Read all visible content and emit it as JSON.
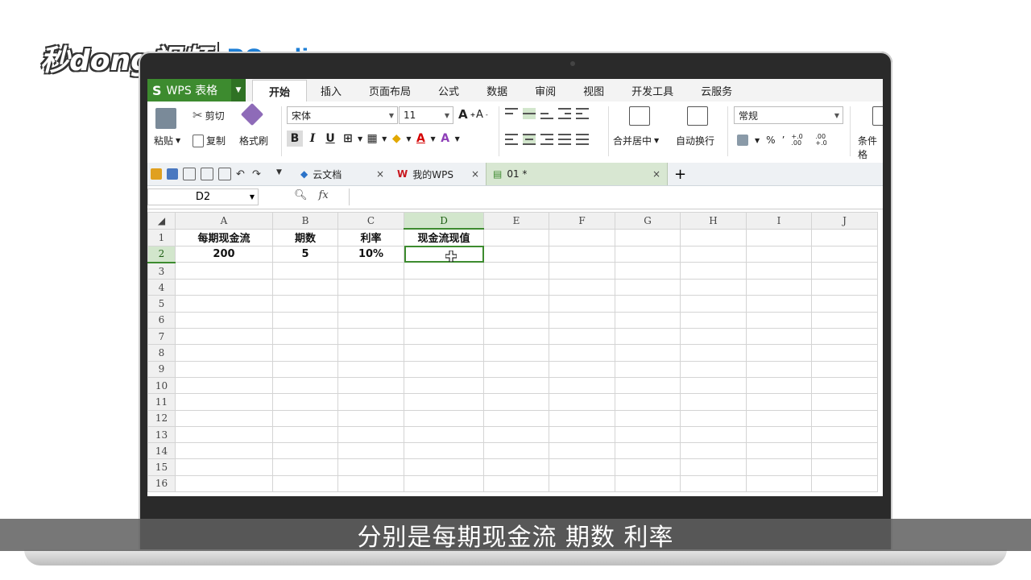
{
  "watermark": {
    "brand_cn": "秒dong视频",
    "brand_en": "PConline"
  },
  "menubar": {
    "app_name": "WPS 表格",
    "app_logo": "S",
    "tabs": [
      {
        "label": "开始",
        "active": true
      },
      {
        "label": "插入"
      },
      {
        "label": "页面布局"
      },
      {
        "label": "公式"
      },
      {
        "label": "数据"
      },
      {
        "label": "审阅"
      },
      {
        "label": "视图"
      },
      {
        "label": "开发工具"
      },
      {
        "label": "云服务"
      }
    ]
  },
  "ribbon": {
    "paste": "粘贴",
    "cut": "剪切",
    "copy": "复制",
    "format_painter": "格式刷",
    "font_name": "宋体",
    "font_size": "11",
    "bold": "B",
    "italic": "I",
    "underline": "U",
    "merge_center": "合并居中",
    "wrap_text": "自动换行",
    "number_format": "常规",
    "percent": "%",
    "comma": "’",
    "inc_decimal": "+.0 .00",
    "dec_decimal": ".00 +.0",
    "conditional": "条件格"
  },
  "docbar": {
    "tabs": [
      {
        "label": "云文档",
        "close": "×"
      },
      {
        "label": "我的WPS",
        "close": "×"
      },
      {
        "label": "01 *",
        "close": "×",
        "active": true
      }
    ],
    "add": "+"
  },
  "formula_bar": {
    "name_box": "D2",
    "fx": "fx",
    "value": ""
  },
  "sheet": {
    "columns": [
      "A",
      "B",
      "C",
      "D",
      "E",
      "F",
      "G",
      "H",
      "I",
      "J"
    ],
    "selected_column": "D",
    "rows": [
      {
        "n": "1",
        "cells": [
          "每期现金流",
          "期数",
          "利率",
          "现金流现值",
          "",
          "",
          "",
          "",
          "",
          ""
        ]
      },
      {
        "n": "2",
        "cells": [
          "200",
          "5",
          "10%",
          "",
          "",
          "",
          "",
          "",
          "",
          ""
        ]
      },
      {
        "n": "3",
        "cells": [
          "",
          "",
          "",
          "",
          "",
          "",
          "",
          "",
          "",
          ""
        ]
      },
      {
        "n": "4",
        "cells": [
          "",
          "",
          "",
          "",
          "",
          "",
          "",
          "",
          "",
          ""
        ]
      },
      {
        "n": "5",
        "cells": [
          "",
          "",
          "",
          "",
          "",
          "",
          "",
          "",
          "",
          ""
        ]
      },
      {
        "n": "6",
        "cells": [
          "",
          "",
          "",
          "",
          "",
          "",
          "",
          "",
          "",
          ""
        ]
      },
      {
        "n": "7",
        "cells": [
          "",
          "",
          "",
          "",
          "",
          "",
          "",
          "",
          "",
          ""
        ]
      },
      {
        "n": "8",
        "cells": [
          "",
          "",
          "",
          "",
          "",
          "",
          "",
          "",
          "",
          ""
        ]
      },
      {
        "n": "9",
        "cells": [
          "",
          "",
          "",
          "",
          "",
          "",
          "",
          "",
          "",
          ""
        ]
      },
      {
        "n": "10",
        "cells": [
          "",
          "",
          "",
          "",
          "",
          "",
          "",
          "",
          "",
          ""
        ]
      },
      {
        "n": "11",
        "cells": [
          "",
          "",
          "",
          "",
          "",
          "",
          "",
          "",
          "",
          ""
        ]
      },
      {
        "n": "12",
        "cells": [
          "",
          "",
          "",
          "",
          "",
          "",
          "",
          "",
          "",
          ""
        ]
      },
      {
        "n": "13",
        "cells": [
          "",
          "",
          "",
          "",
          "",
          "",
          "",
          "",
          "",
          ""
        ]
      },
      {
        "n": "14",
        "cells": [
          "",
          "",
          "",
          "",
          "",
          "",
          "",
          "",
          "",
          ""
        ]
      },
      {
        "n": "15",
        "cells": [
          "",
          "",
          "",
          "",
          "",
          "",
          "",
          "",
          "",
          ""
        ]
      },
      {
        "n": "16",
        "cells": [
          "",
          "",
          "",
          "",
          "",
          "",
          "",
          "",
          "",
          ""
        ]
      }
    ]
  },
  "subtitle": "分别是每期现金流 期数 利率",
  "colors": {
    "accent": "#3d8b2f",
    "brand_blue": "#1e7fd6"
  }
}
